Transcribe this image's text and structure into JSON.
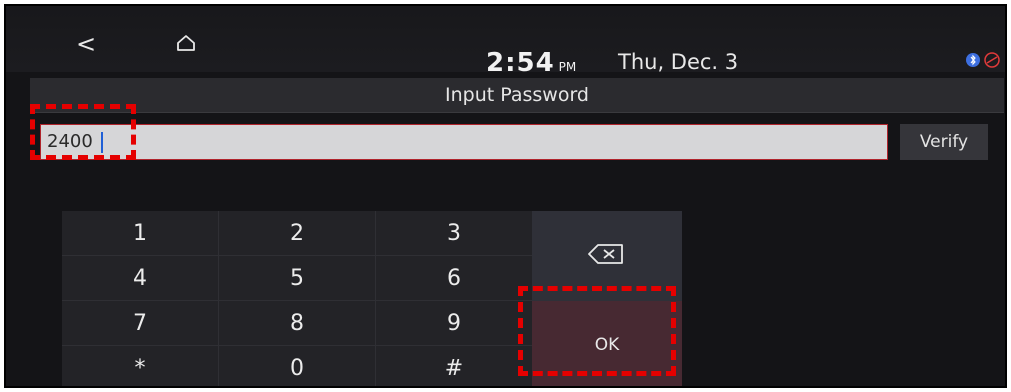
{
  "status_bar": {
    "back_label": "<",
    "time": "2:54",
    "ampm": "PM",
    "date": "Thu, Dec. 3",
    "icons": [
      "bluetooth-icon",
      "phone-signal-icon"
    ]
  },
  "header": {
    "title": "Input Password"
  },
  "password_input": {
    "value": "2400"
  },
  "verify_button": {
    "label": "Verify"
  },
  "keypad": {
    "keys": [
      "1",
      "2",
      "3",
      "4",
      "5",
      "6",
      "7",
      "8",
      "9",
      "*",
      "0",
      "#"
    ]
  },
  "actions": {
    "backspace_icon": "backspace-icon",
    "ok_label": "OK"
  },
  "colors": {
    "background": "#141417",
    "accent_red": "#b0242c",
    "highlight": "#e50000",
    "ok_button": "#472932"
  }
}
